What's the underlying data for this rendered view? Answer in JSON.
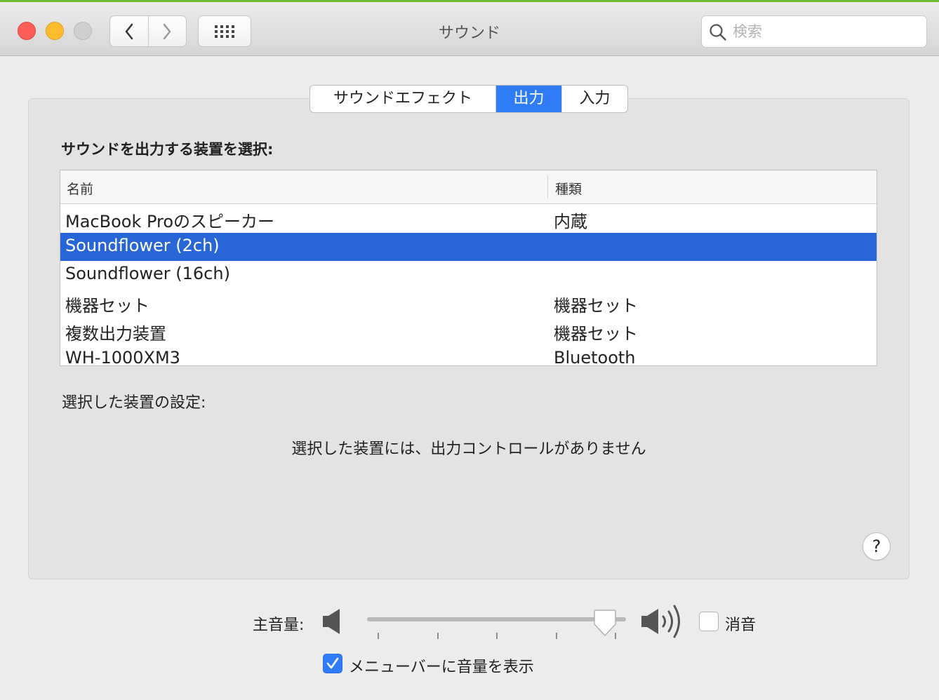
{
  "window": {
    "title": "サウンド"
  },
  "search": {
    "placeholder": "検索",
    "value": ""
  },
  "tabs": [
    {
      "label": "サウンドエフェクト",
      "selected": false
    },
    {
      "label": "出力",
      "selected": true
    },
    {
      "label": "入力",
      "selected": false
    }
  ],
  "output": {
    "section_label": "サウンドを出力する装置を選択:",
    "columns": [
      "名前",
      "種類"
    ],
    "devices": [
      {
        "name": "MacBook Proのスピーカー",
        "type": "内蔵"
      },
      {
        "name": "Soundflower (2ch)",
        "type": "",
        "selected": true
      },
      {
        "name": "Soundflower (16ch)",
        "type": ""
      },
      {
        "name": "機器セット",
        "type": "機器セット"
      },
      {
        "name": "複数出力装置",
        "type": "機器セット"
      },
      {
        "name": "WH-1000XM3",
        "type": "Bluetooth"
      }
    ],
    "settings_label": "選択した装置の設定:",
    "no_controls_message": "選択した装置には、出力コントロールがありません"
  },
  "help": {
    "label": "?"
  },
  "volume": {
    "label": "主音量:",
    "level_fraction": 0.92,
    "mute_label": "消音",
    "muted": false
  },
  "menubar": {
    "label": "メニューバーに音量を表示",
    "checked": true
  },
  "colors": {
    "accent": "#2f7cf6",
    "selection": "#2865d7",
    "close": "#fc5f57",
    "minimize": "#fdbc2e"
  }
}
